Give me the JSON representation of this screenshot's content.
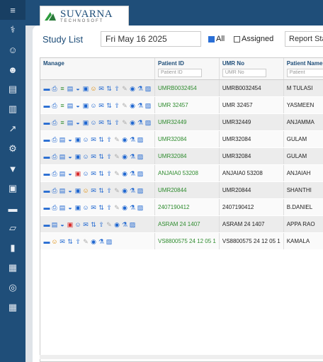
{
  "sidebar": {
    "items": [
      "menu-icon",
      "user-doctor-icon",
      "user-icon",
      "users-icon",
      "id-card-icon",
      "document-icon",
      "chart-icon",
      "settings-icon",
      "location-icon",
      "lock-icon",
      "card-icon",
      "folder-icon",
      "door-icon",
      "clipboard-icon",
      "globe-icon",
      "calendar-icon"
    ]
  },
  "logo": {
    "title": "SUVARNA",
    "subtitle": "TECHNOSOFT"
  },
  "toolbar": {
    "title": "Study List",
    "date": "Fri May 16 2025",
    "all_label": "All",
    "assigned_label": "Assigned",
    "report_status": "Report Status"
  },
  "table": {
    "headers": {
      "manage": "Manage",
      "patient_id": "Patient ID",
      "umr_no": "UMR No",
      "patient_name": "Patient Name"
    },
    "filters": {
      "patient_id": "Patient ID",
      "umr_no": "UMR No",
      "patient_name": "Patient"
    },
    "rows": [
      {
        "patient_id": "UMRB0032454",
        "umr_no": "UMRB0032454",
        "name": "M TULASI",
        "icons": [
          "bars-icon",
          "print-icon",
          "list-icon",
          "doc-icon",
          "share-icon",
          "lock-icon",
          "user-orange-icon",
          "mail-icon",
          "transfer-icon",
          "upload-icon",
          "edit-icon",
          "viewer-icon",
          "flask-icon",
          "report-icon"
        ]
      },
      {
        "patient_id": "UMR 32457",
        "umr_no": "UMR 32457",
        "name": "YASMEEN",
        "icons": [
          "bars-icon",
          "print-icon",
          "list-icon",
          "doc-icon",
          "share-icon",
          "lock-icon",
          "user-icon",
          "mail-icon",
          "transfer-icon",
          "upload-icon",
          "edit-icon",
          "viewer-icon",
          "flask-icon",
          "report-icon"
        ]
      },
      {
        "patient_id": "UMR32449",
        "umr_no": "UMR32449",
        "name": "ANJAMMA",
        "icons": [
          "bars-icon",
          "print-icon",
          "list-icon",
          "doc-icon",
          "share-icon",
          "lock-icon",
          "user-icon",
          "mail-icon",
          "transfer-icon",
          "upload-icon",
          "edit-icon",
          "viewer-icon",
          "flask-icon",
          "report-icon"
        ]
      },
      {
        "patient_id": "UMR32084",
        "umr_no": "UMR32084",
        "name": "GULAM",
        "icons": [
          "bars-icon",
          "print-icon",
          "doc-icon",
          "share-icon",
          "lock-icon",
          "user-icon",
          "mail-icon",
          "transfer-icon",
          "upload-icon",
          "edit-icon",
          "viewer-icon",
          "flask-icon",
          "report-icon"
        ]
      },
      {
        "patient_id": "UMR32084",
        "umr_no": "UMR32084",
        "name": "GULAM",
        "icons": [
          "bars-icon",
          "print-icon",
          "doc-icon",
          "share-icon",
          "lock-icon",
          "user-icon",
          "mail-icon",
          "transfer-icon",
          "upload-icon",
          "edit-icon",
          "viewer-icon",
          "flask-icon",
          "report-icon"
        ]
      },
      {
        "patient_id": "ANJAIA0 53208",
        "umr_no": "ANJAIA0 53208",
        "name": "ANJAIAH",
        "icons": [
          "bars-icon",
          "print-icon",
          "doc-icon",
          "share-icon",
          "lock-red-icon",
          "user-icon",
          "mail-icon",
          "transfer-icon",
          "upload-icon",
          "edit-icon",
          "viewer-icon",
          "flask-icon",
          "report-icon"
        ]
      },
      {
        "patient_id": "UMR20844",
        "umr_no": "UMR20844",
        "name": "SHANTHI",
        "icons": [
          "bars-icon",
          "print-icon",
          "doc-icon",
          "share-icon",
          "lock-icon",
          "user-orange-icon",
          "mail-icon",
          "transfer-icon",
          "upload-icon",
          "edit-icon",
          "viewer-icon",
          "flask-icon",
          "report-icon"
        ]
      },
      {
        "patient_id": "2407190412",
        "umr_no": "2407190412",
        "name": "B.DANIEL",
        "icons": [
          "bars-icon",
          "print-icon",
          "doc-icon",
          "share-icon",
          "lock-icon",
          "user-icon",
          "mail-icon",
          "transfer-icon",
          "upload-icon",
          "edit-icon",
          "viewer-icon",
          "flask-icon",
          "report-icon"
        ]
      },
      {
        "patient_id": "ASRAM 24 1407",
        "umr_no": "ASRAM 24 1407",
        "name": "APPA RAO",
        "icons": [
          "bars-icon",
          "doc-icon",
          "share-icon",
          "lock-red-icon",
          "user-icon",
          "mail-icon",
          "transfer-icon",
          "upload-icon",
          "edit-icon",
          "viewer-icon",
          "flask-icon",
          "report-icon"
        ]
      },
      {
        "patient_id": "VS8800575 24 12 05 1",
        "umr_no": "VS8800575 24 12 05 1",
        "name": "KAMALA",
        "icons": [
          "bars-icon",
          "user-orange-icon",
          "mail-icon",
          "transfer-icon",
          "upload-icon",
          "edit-icon",
          "viewer-icon",
          "flask-icon",
          "report-icon"
        ]
      }
    ]
  }
}
